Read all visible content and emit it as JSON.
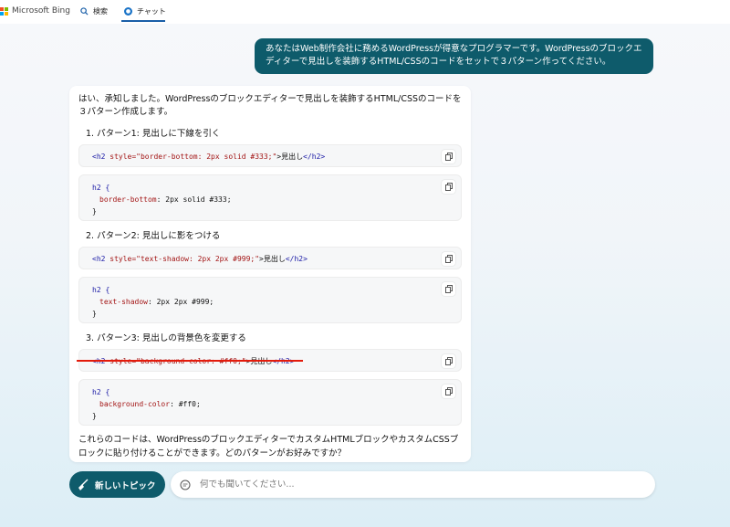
{
  "header": {
    "brand": "Microsoft Bing",
    "nav_search": "検索",
    "nav_chat": "チャット",
    "logo_colors": [
      "#f25022",
      "#7fba00",
      "#00a4ef",
      "#ffb900"
    ]
  },
  "user_message": "あなたはWeb制作会社に務めるWordPressが得意なプログラマーです。WordPressのブロックエディターで見出しを装飾するHTML/CSSのコードをセットで３パターン作ってください。",
  "bot": {
    "intro": "はい、承知しました。WordPressのブロックエディターで見出しを装飾するHTML/CSSのコードを３パターン作成します。",
    "patterns": [
      {
        "heading": "1. パターン1: 見出しに下線を引く",
        "html": {
          "open": "<h2",
          "attr": " style=",
          "val": "\"border-bottom: 2px solid #333;\"",
          "close": ">",
          "text": "見出し",
          "end": "</h2>"
        },
        "css": {
          "selector": "h2 {",
          "prop": "border-bottom",
          "value": ": 2px solid #333;",
          "end": "}"
        }
      },
      {
        "heading": "2. パターン2: 見出しに影をつける",
        "html": {
          "open": "<h2",
          "attr": " style=",
          "val": "\"text-shadow: 2px 2px #999;\"",
          "close": ">",
          "text": "見出し",
          "end": "</h2>"
        },
        "css": {
          "selector": "h2 {",
          "prop": "text-shadow",
          "value": ": 2px 2px #999;",
          "end": "}"
        }
      },
      {
        "heading": "3. パターン3: 見出しの背景色を変更する",
        "html": {
          "open": "<h2",
          "attr": " style=",
          "val": "\"background-color: #ff0;\"",
          "close": ">",
          "text": "見出し",
          "end": "</h2>"
        },
        "css": {
          "selector": "h2 {",
          "prop": "background-color",
          "value": ": #ff0;",
          "end": "}"
        }
      }
    ],
    "outro": "これらのコードは、WordPressのブロックエディターでカスタムHTMLブロックやカスタムCSSブロックに貼り付けることができます。どのパターンがお好みですか？"
  },
  "footer": {
    "new_topic_label": "新しいトピック",
    "input_placeholder": "何でも聞いてください..."
  },
  "icons": {
    "search": "search-icon",
    "chat": "chat-icon",
    "copy": "copy-icon",
    "broom": "broom-icon",
    "chat_input": "chat-bubble-icon"
  }
}
